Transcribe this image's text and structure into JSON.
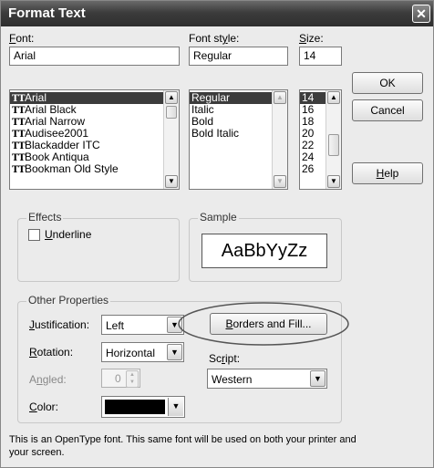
{
  "window": {
    "title": "Format Text",
    "close_glyph": "✕"
  },
  "font": {
    "label": "Font:",
    "value": "Arial",
    "items": [
      "Arial",
      "Arial Black",
      "Arial Narrow",
      "Audisee2001",
      "Blackadder ITC",
      "Book Antiqua",
      "Bookman Old Style"
    ],
    "selected": "Arial",
    "item_icon": "truetype-font-icon"
  },
  "style": {
    "label": "Font style:",
    "value": "Regular",
    "items": [
      "Regular",
      "Italic",
      "Bold",
      "Bold Italic"
    ],
    "selected": "Regular"
  },
  "size": {
    "label": "Size:",
    "value": "14",
    "items": [
      "14",
      "16",
      "18",
      "20",
      "22",
      "24",
      "26"
    ],
    "selected": "14"
  },
  "buttons": {
    "ok": "OK",
    "cancel": "Cancel",
    "help": "Help",
    "borders_fill": "Borders and Fill..."
  },
  "effects": {
    "title": "Effects",
    "underline_label": "Underline",
    "underline_checked": false
  },
  "sample": {
    "title": "Sample",
    "text": "AaBbYyZz"
  },
  "other": {
    "title": "Other Properties",
    "justification_label": "Justification:",
    "justification_value": "Left",
    "rotation_label": "Rotation:",
    "rotation_value": "Horizontal",
    "angled_label": "Angled:",
    "angled_value": "0",
    "color_label": "Color:",
    "color_value": "#000000",
    "script_label": "Script:",
    "script_value": "Western"
  },
  "footer": "This is an OpenType font. This same font will be used on both your printer and your screen."
}
